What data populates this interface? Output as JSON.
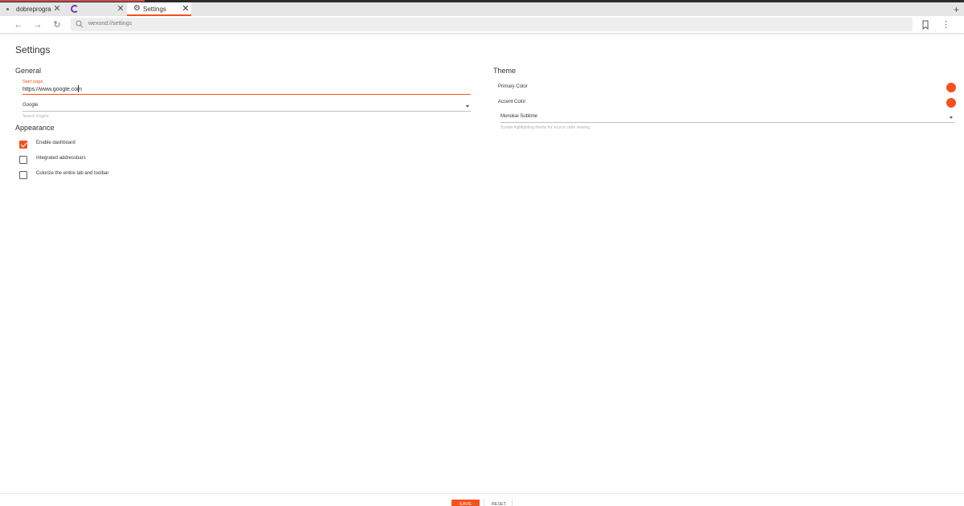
{
  "tabs": [
    {
      "label": "dobreprogra...",
      "icon": "dot-icon"
    },
    {
      "label": "",
      "icon": "loading-spinner-icon"
    },
    {
      "label": "Settings",
      "icon": "gear-icon",
      "active": true
    }
  ],
  "toolbar": {
    "url": "wexond://settings"
  },
  "page": {
    "title": "Settings"
  },
  "general": {
    "title": "General",
    "start_page_label": "Start page",
    "start_page_value": "https://www.google.com",
    "search_engine_value": "Google",
    "search_engine_help": "Search Engine"
  },
  "appearance": {
    "title": "Appearance",
    "options": [
      {
        "label": "Enable dashboard",
        "checked": true
      },
      {
        "label": "Integrated addressbars",
        "checked": false
      },
      {
        "label": "Colorize the entire tab and toolbar",
        "checked": false
      }
    ]
  },
  "theme": {
    "title": "Theme",
    "primary_color_label": "Primary Color",
    "accent_color_label": "Accent Color",
    "primary_color": "#f4511e",
    "accent_color": "#f4511e",
    "syntax_value": "Monokai Sublime",
    "syntax_help": "Syntax highlighting theme for source code viewing"
  },
  "footer": {
    "save_label": "SAVE",
    "reset_label": "RESET"
  },
  "colors": {
    "accent": "#f4511e"
  }
}
